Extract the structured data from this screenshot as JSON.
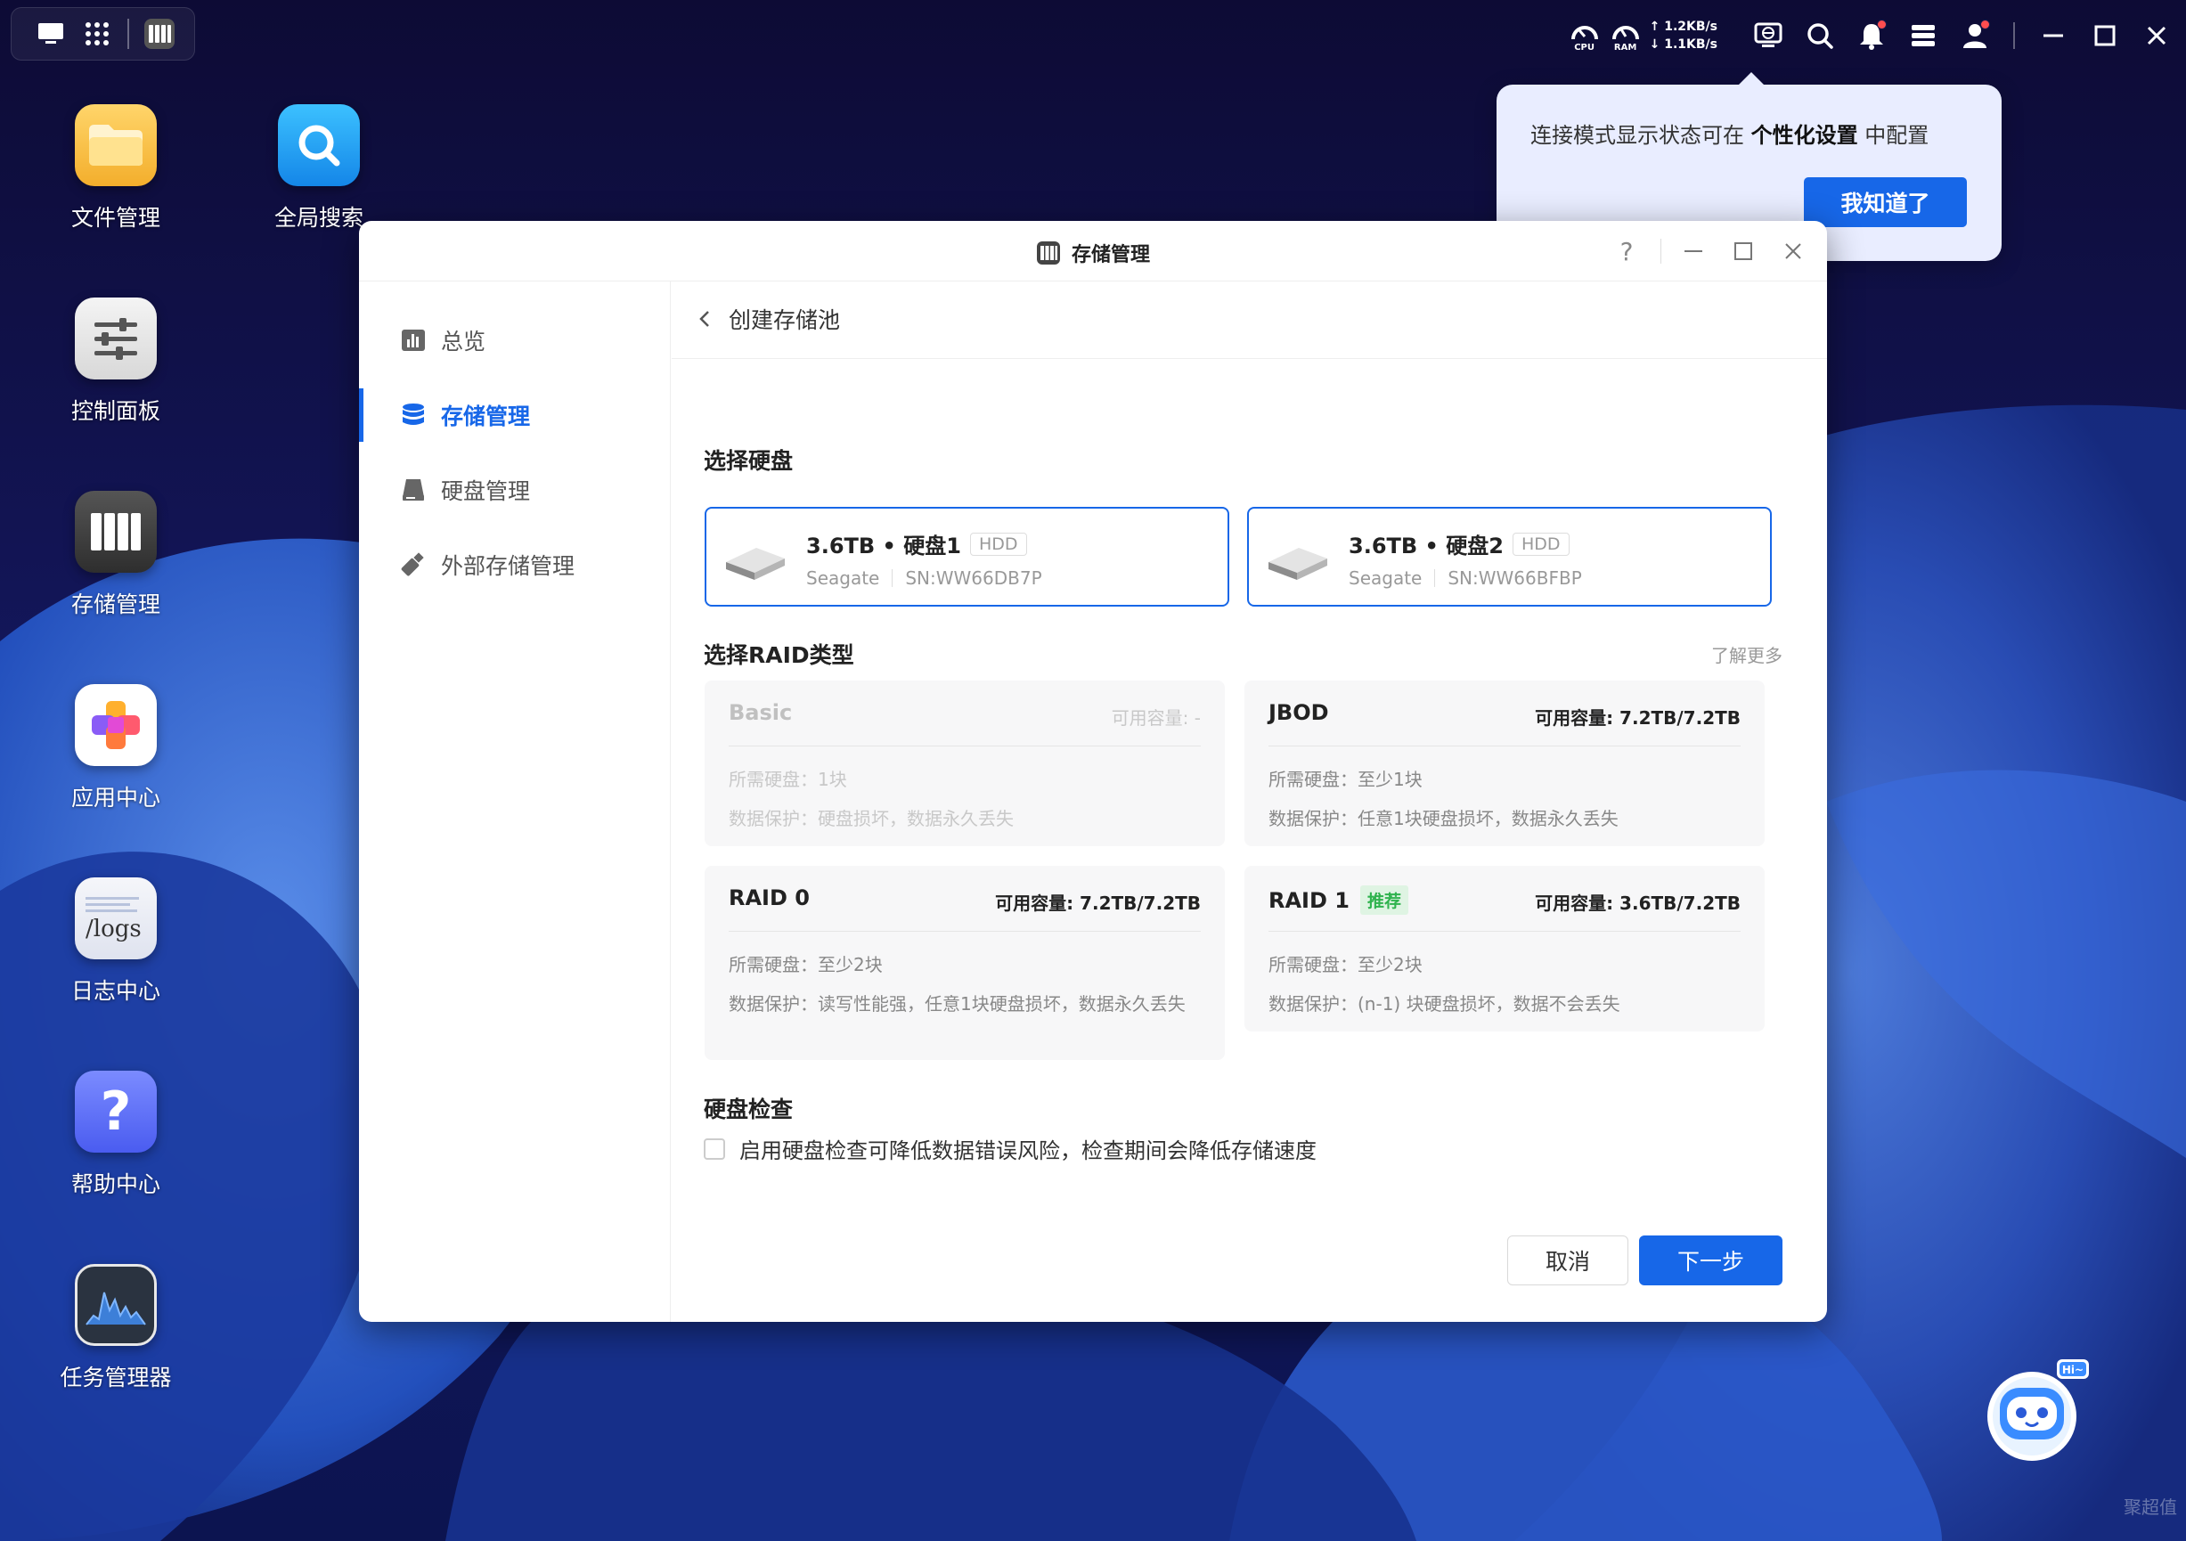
{
  "topbar": {
    "cpu_label": "CPU",
    "ram_label": "RAM",
    "upload_speed": "↑ 1.2KB/s",
    "download_speed": "↓ 1.1KB/s"
  },
  "desktop": {
    "icons": [
      {
        "label": "文件管理",
        "icon": "folder-icon"
      },
      {
        "label": "全局搜索",
        "icon": "search-app-icon"
      },
      {
        "label": "控制面板",
        "icon": "control-panel-icon"
      },
      {
        "label": "存储管理",
        "icon": "storage-icon"
      },
      {
        "label": "应用中心",
        "icon": "app-center-icon"
      },
      {
        "label": "日志中心",
        "icon": "logs-icon"
      },
      {
        "label": "帮助中心",
        "icon": "help-icon"
      },
      {
        "label": "任务管理器",
        "icon": "task-manager-icon"
      }
    ],
    "logs_icon_text": "/logs",
    "help_icon_text": "?"
  },
  "popover": {
    "msg_prefix": "连接模式显示状态可在 ",
    "msg_bold": "个性化设置",
    "msg_suffix": " 中配置",
    "ok_label": "我知道了"
  },
  "window": {
    "title": "存储管理",
    "help_glyph": "?",
    "sidebar": [
      {
        "label": "总览",
        "icon": "overview-icon"
      },
      {
        "label": "存储管理",
        "icon": "database-icon",
        "active": true
      },
      {
        "label": "硬盘管理",
        "icon": "hard-drive-icon"
      },
      {
        "label": "外部存储管理",
        "icon": "usb-drive-icon"
      }
    ],
    "page_title": "创建存储池",
    "select_disk_title": "选择硬盘",
    "disks": [
      {
        "title": "3.6TB • 硬盘1",
        "tag": "HDD",
        "brand": "Seagate",
        "sn": "SN:WW66DB7P"
      },
      {
        "title": "3.6TB • 硬盘2",
        "tag": "HDD",
        "brand": "Seagate",
        "sn": "SN:WW66BFBP"
      }
    ],
    "raid_title": "选择RAID类型",
    "learn_more": "了解更多",
    "raids": [
      {
        "name": "Basic",
        "capacity": "可用容量: -",
        "req": "所需硬盘：1块",
        "prot": "数据保护：硬盘损坏，数据永久丢失",
        "disabled": true
      },
      {
        "name": "JBOD",
        "capacity": "可用容量: 7.2TB/7.2TB",
        "req": "所需硬盘：至少1块",
        "prot": "数据保护：任意1块硬盘损坏，数据永久丢失"
      },
      {
        "name": "RAID 0",
        "capacity": "可用容量: 7.2TB/7.2TB",
        "req": "所需硬盘：至少2块",
        "prot": "数据保护：读写性能强，任意1块硬盘损坏，数据永久丢失"
      },
      {
        "name": "RAID 1",
        "badge": "推荐",
        "capacity": "可用容量: 3.6TB/7.2TB",
        "req": "所需硬盘：至少2块",
        "prot": "数据保护：(n-1) 块硬盘损坏，数据不会丢失"
      }
    ],
    "disk_check_title": "硬盘检查",
    "disk_check_label": "启用硬盘检查可降低数据错误风险，检查期间会降低存储速度",
    "cancel_label": "取消",
    "next_label": "下一步"
  },
  "mascot": {
    "bubble": "Hi~"
  },
  "watermark": "聚超值"
}
